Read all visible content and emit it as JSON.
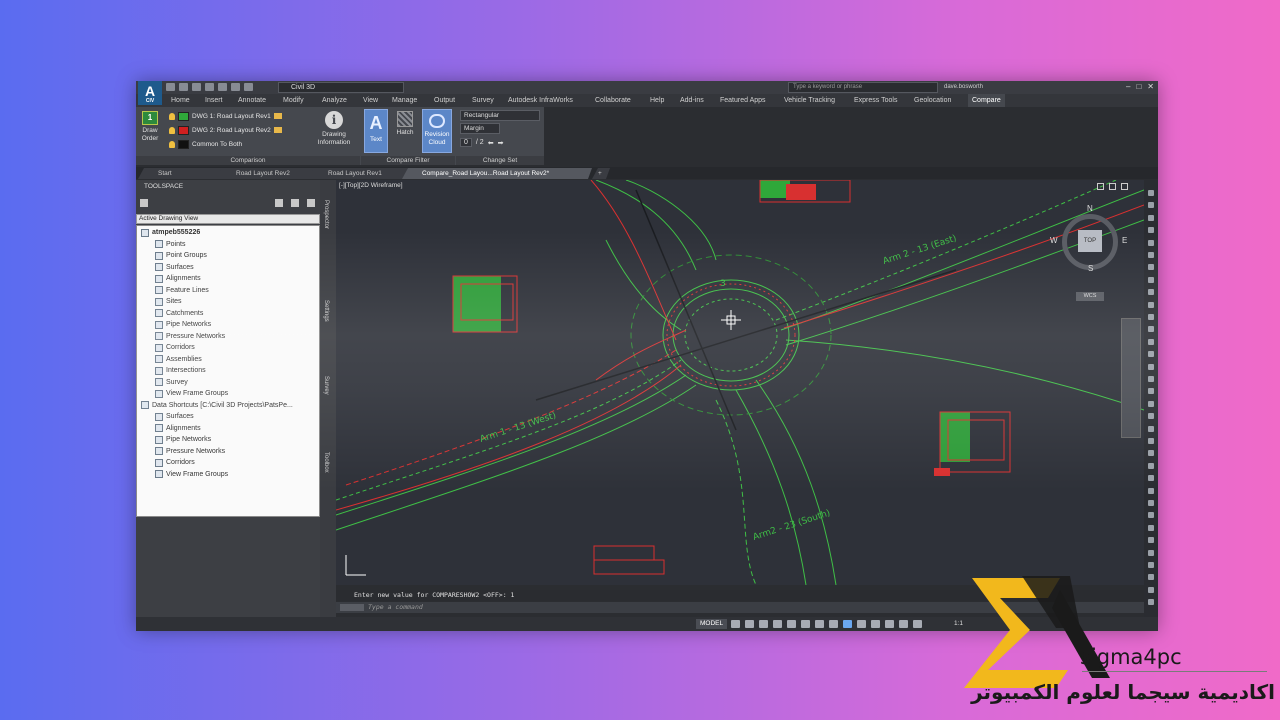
{
  "app": {
    "logo": "A",
    "logo_sub": "CIV",
    "workspace": "Civil 3D",
    "search_placeholder": "Type a keyword or phrase",
    "user": "dave.bosworth"
  },
  "menu_tabs": [
    "Home",
    "Insert",
    "Annotate",
    "Modify",
    "Analyze",
    "View",
    "Manage",
    "Output",
    "Survey",
    "Autodesk InfraWorks",
    "Collaborate",
    "Help",
    "Add-ins",
    "Featured Apps",
    "Vehicle Tracking",
    "Express Tools",
    "Geolocation",
    "Compare"
  ],
  "ribbon": {
    "draw_order": "Draw Order",
    "draw_order_num": "1",
    "dwg1": "DWG 1: Road Layout Rev1",
    "dwg2": "DWG 2: Road Layout Rev2",
    "common": "Common To Both",
    "drawing_info": "Drawing Information",
    "text": "Text",
    "hatch": "Hatch",
    "revision_cloud": "Revision Cloud",
    "shape": "Rectangular",
    "margin": "Margin",
    "page_current": "0",
    "page_total": "/ 2",
    "group_comparison": "Comparison",
    "group_filter": "Compare Filter",
    "group_change_set": "Change Set",
    "colors": {
      "dwg1": "#2fa83a",
      "dwg2": "#d02020",
      "common": "#111111"
    }
  },
  "doc_tabs": [
    "Start",
    "Road Layout Rev2",
    "Road Layout Rev1",
    "Compare_Road Layou...Road Layout Rev2*",
    "+"
  ],
  "toolspace": {
    "title": "TOOLSPACE",
    "view": "Active Drawing View",
    "tree": [
      {
        "label": "atmpeb555226",
        "level": 0,
        "root": true
      },
      {
        "label": "Points",
        "level": 1
      },
      {
        "label": "Point Groups",
        "level": 1
      },
      {
        "label": "Surfaces",
        "level": 1
      },
      {
        "label": "Alignments",
        "level": 1
      },
      {
        "label": "Feature Lines",
        "level": 1
      },
      {
        "label": "Sites",
        "level": 1
      },
      {
        "label": "Catchments",
        "level": 1
      },
      {
        "label": "Pipe Networks",
        "level": 1
      },
      {
        "label": "Pressure Networks",
        "level": 1
      },
      {
        "label": "Corridors",
        "level": 1
      },
      {
        "label": "Assemblies",
        "level": 1
      },
      {
        "label": "Intersections",
        "level": 1
      },
      {
        "label": "Survey",
        "level": 1
      },
      {
        "label": "View Frame Groups",
        "level": 1
      },
      {
        "label": "Data Shortcuts [C:\\Civil 3D Projects\\PatsPe...",
        "level": 0
      },
      {
        "label": "Surfaces",
        "level": 1
      },
      {
        "label": "Alignments",
        "level": 1
      },
      {
        "label": "Pipe Networks",
        "level": 1
      },
      {
        "label": "Pressure Networks",
        "level": 1
      },
      {
        "label": "Corridors",
        "level": 1
      },
      {
        "label": "View Frame Groups",
        "level": 1
      }
    ],
    "side_tabs": [
      "Prospector",
      "Settings",
      "Survey",
      "Toolbox"
    ]
  },
  "viewport": {
    "label": "[-][Top][2D Wireframe]",
    "viewcube_face": "TOP",
    "compass": {
      "n": "N",
      "s": "S",
      "e": "E",
      "w": "W"
    },
    "wcs": "WCS",
    "annotations": [
      "Arm 2 - 13 (East)",
      "Arm 1 - 13 (West)",
      "Arm2 - 23 (South)",
      "3"
    ]
  },
  "command": {
    "history": "Enter new value for COMPARESHOW2 <OFF>: 1",
    "placeholder": "Type a command"
  },
  "status": {
    "model": "MODEL",
    "zoom": "1:1"
  },
  "watermark": {
    "brand": "sigma4pc",
    "arabic": "اكاديمية سيجما لعلوم الكمبيوتر"
  }
}
